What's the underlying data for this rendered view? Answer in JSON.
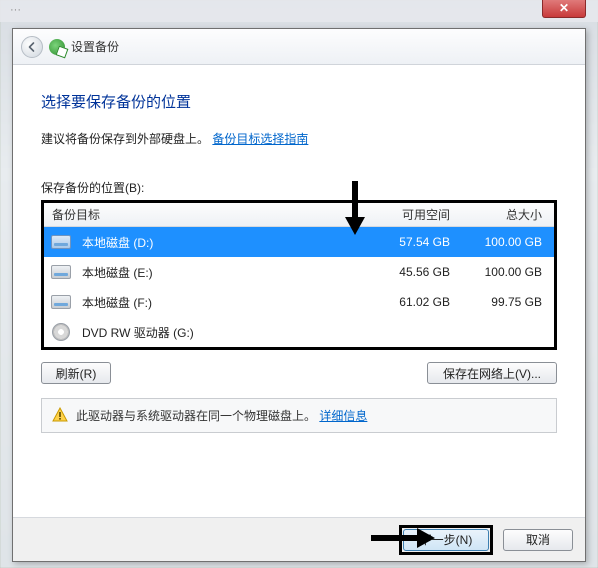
{
  "window": {
    "title": "设置备份",
    "close_tooltip": "关闭"
  },
  "page": {
    "heading": "选择要保存备份的位置",
    "intro_text": "建议将备份保存到外部硬盘上。",
    "intro_link": "备份目标选择指南",
    "list_label": "保存备份的位置(B):"
  },
  "columns": {
    "target": "备份目标",
    "free": "可用空间",
    "total": "总大小"
  },
  "drives": [
    {
      "name": "本地磁盘 (D:)",
      "free": "57.54 GB",
      "total": "100.00 GB",
      "selected": true,
      "kind": "hdd"
    },
    {
      "name": "本地磁盘 (E:)",
      "free": "45.56 GB",
      "total": "100.00 GB",
      "selected": false,
      "kind": "hdd"
    },
    {
      "name": "本地磁盘 (F:)",
      "free": "61.02 GB",
      "total": "99.75 GB",
      "selected": false,
      "kind": "hdd"
    },
    {
      "name": "DVD RW 驱动器 (G:)",
      "free": "",
      "total": "",
      "selected": false,
      "kind": "dvd"
    }
  ],
  "buttons": {
    "refresh": "刷新(R)",
    "save_network": "保存在网络上(V)...",
    "next": "下一步(N)",
    "cancel": "取消"
  },
  "warning": {
    "text": "此驱动器与系统驱动器在同一个物理磁盘上。",
    "link": "详细信息"
  }
}
